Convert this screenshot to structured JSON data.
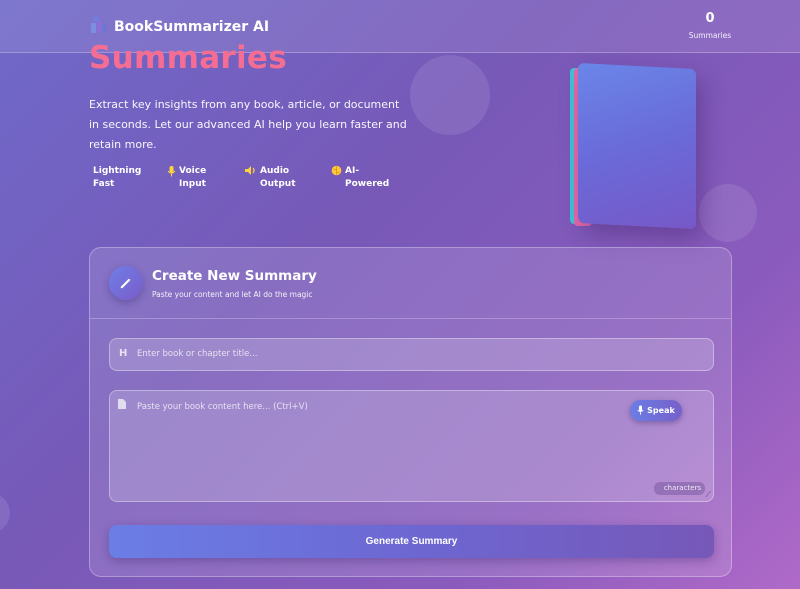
{
  "header": {
    "app_name": "BookSummarizer AI",
    "logo_icon": "books-icon",
    "stats": {
      "count": "0",
      "label": "Summaries"
    }
  },
  "hero": {
    "title": "Summaries",
    "description": "Extract key insights from any book, article, or document in seconds. Let our advanced AI help you learn faster and retain more.",
    "features": [
      {
        "label_line1": "Lightning",
        "label_line2": "Fast",
        "icon": "lightning-icon"
      },
      {
        "label_line1": "Voice",
        "label_line2": "Input",
        "icon": "microphone-icon"
      },
      {
        "label_line1": "Audio",
        "label_line2": "Output",
        "icon": "speaker-icon"
      },
      {
        "label_line1": "AI-",
        "label_line2": "Powered",
        "icon": "brain-icon"
      }
    ]
  },
  "card": {
    "title": "Create New Summary",
    "subtitle": "Paste your content and let AI do the magic",
    "title_input": {
      "placeholder": "Enter book or chapter title...",
      "icon": "heading-icon"
    },
    "content_input": {
      "placeholder": "Paste your book content here... (Ctrl+V)",
      "icon": "file-icon"
    },
    "speak_button": "Speak",
    "char_count_label": "characters",
    "generate_button": "Generate Summary"
  },
  "colors": {
    "accent_title": "#f56d92",
    "feature_icon": "#ffd43b",
    "button_start": "#6b7ee6",
    "button_end": "#7658b8"
  }
}
